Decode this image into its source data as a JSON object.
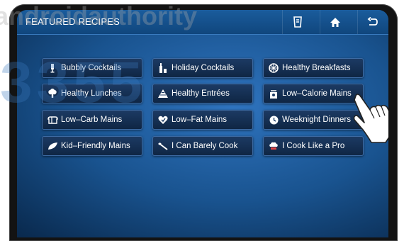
{
  "header": {
    "title": "FEATURED RECIPES",
    "buttons": [
      {
        "name": "recipe-card-button",
        "icon": "recipe-card-icon"
      },
      {
        "name": "home-button",
        "icon": "home-icon"
      },
      {
        "name": "back-button",
        "icon": "back-arrow-icon"
      }
    ]
  },
  "recipes": [
    {
      "label": "Bubbly Cocktails",
      "icon": "cocktail-glass-icon"
    },
    {
      "label": "Holiday Cocktails",
      "icon": "bottles-icon"
    },
    {
      "label": "Healthy Breakfasts",
      "icon": "grapefruit-icon"
    },
    {
      "label": "Healthy Lunches",
      "icon": "broccoli-icon"
    },
    {
      "label": "Healthy Entrées",
      "icon": "pyramid-icon"
    },
    {
      "label": "Low–Calorie Mains",
      "icon": "scale-icon"
    },
    {
      "label": "Low–Carb Mains",
      "icon": "bread-icon"
    },
    {
      "label": "Low–Fat Mains",
      "icon": "heart-icon"
    },
    {
      "label": "Weeknight Dinners",
      "icon": "clock-icon"
    },
    {
      "label": "Kid–Friendly Mains",
      "icon": "leaf-icon"
    },
    {
      "label": "I Can Barely Cook",
      "icon": "spoon-icon"
    },
    {
      "label": "I Cook Like a Pro",
      "icon": "chef-hat-icon"
    }
  ],
  "watermark": {
    "line1": "androidauthority",
    "line2": "3355"
  },
  "colors": {
    "header": "#10467d",
    "tile": "#0f2644",
    "tile_border": "#3d6aa2",
    "frame": "#131313"
  }
}
